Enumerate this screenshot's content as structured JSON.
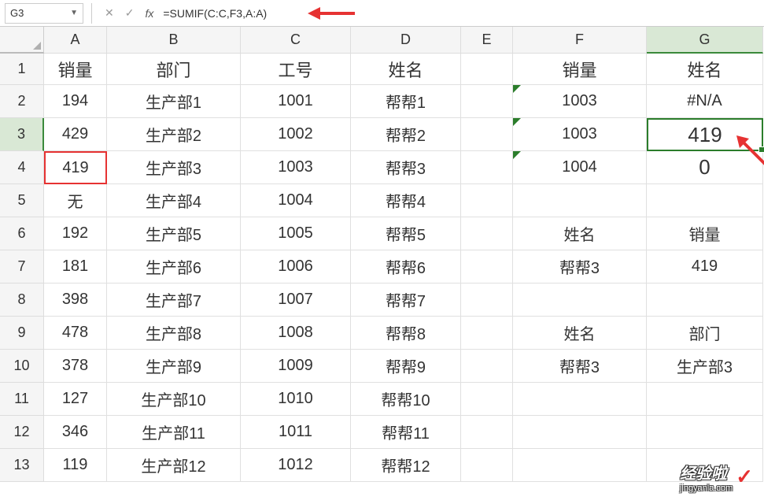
{
  "name_box": "G3",
  "formula": "=SUMIF(C:C,F3,A:A)",
  "columns": [
    "A",
    "B",
    "C",
    "D",
    "E",
    "F",
    "G"
  ],
  "rows": [
    "1",
    "2",
    "3",
    "4",
    "5",
    "6",
    "7",
    "8",
    "9",
    "10",
    "11",
    "12",
    "13"
  ],
  "header_row": {
    "A": "销量",
    "B": "部门",
    "C": "工号",
    "D": "姓名",
    "E": "",
    "F": "销量",
    "G": "姓名"
  },
  "data": [
    {
      "A": "194",
      "B": "生产部1",
      "C": "1001",
      "D": "帮帮1",
      "E": "",
      "F": "1003",
      "G": "#N/A"
    },
    {
      "A": "429",
      "B": "生产部2",
      "C": "1002",
      "D": "帮帮2",
      "E": "",
      "F": "1003",
      "G": "419"
    },
    {
      "A": "419",
      "B": "生产部3",
      "C": "1003",
      "D": "帮帮3",
      "E": "",
      "F": "1004",
      "G": "0"
    },
    {
      "A": "无",
      "B": "生产部4",
      "C": "1004",
      "D": "帮帮4",
      "E": "",
      "F": "",
      "G": ""
    },
    {
      "A": "192",
      "B": "生产部5",
      "C": "1005",
      "D": "帮帮5",
      "E": "",
      "F": "姓名",
      "G": "销量"
    },
    {
      "A": "181",
      "B": "生产部6",
      "C": "1006",
      "D": "帮帮6",
      "E": "",
      "F": "帮帮3",
      "G": "419"
    },
    {
      "A": "398",
      "B": "生产部7",
      "C": "1007",
      "D": "帮帮7",
      "E": "",
      "F": "",
      "G": ""
    },
    {
      "A": "478",
      "B": "生产部8",
      "C": "1008",
      "D": "帮帮8",
      "E": "",
      "F": "姓名",
      "G": "部门"
    },
    {
      "A": "378",
      "B": "生产部9",
      "C": "1009",
      "D": "帮帮9",
      "E": "",
      "F": "帮帮3",
      "G": "生产部3"
    },
    {
      "A": "127",
      "B": "生产部10",
      "C": "1010",
      "D": "帮帮10",
      "E": "",
      "F": "",
      "G": ""
    },
    {
      "A": "346",
      "B": "生产部11",
      "C": "1011",
      "D": "帮帮11",
      "E": "",
      "F": "",
      "G": ""
    },
    {
      "A": "119",
      "B": "生产部12",
      "C": "1012",
      "D": "帮帮12",
      "E": "",
      "F": "",
      "G": ""
    }
  ],
  "active_cell": "G3",
  "active_col": "G",
  "active_row": "3",
  "highlight_cell": "A4",
  "watermark": {
    "text": "经验啦",
    "sub": "jingyanla.com",
    "check": "✓"
  }
}
